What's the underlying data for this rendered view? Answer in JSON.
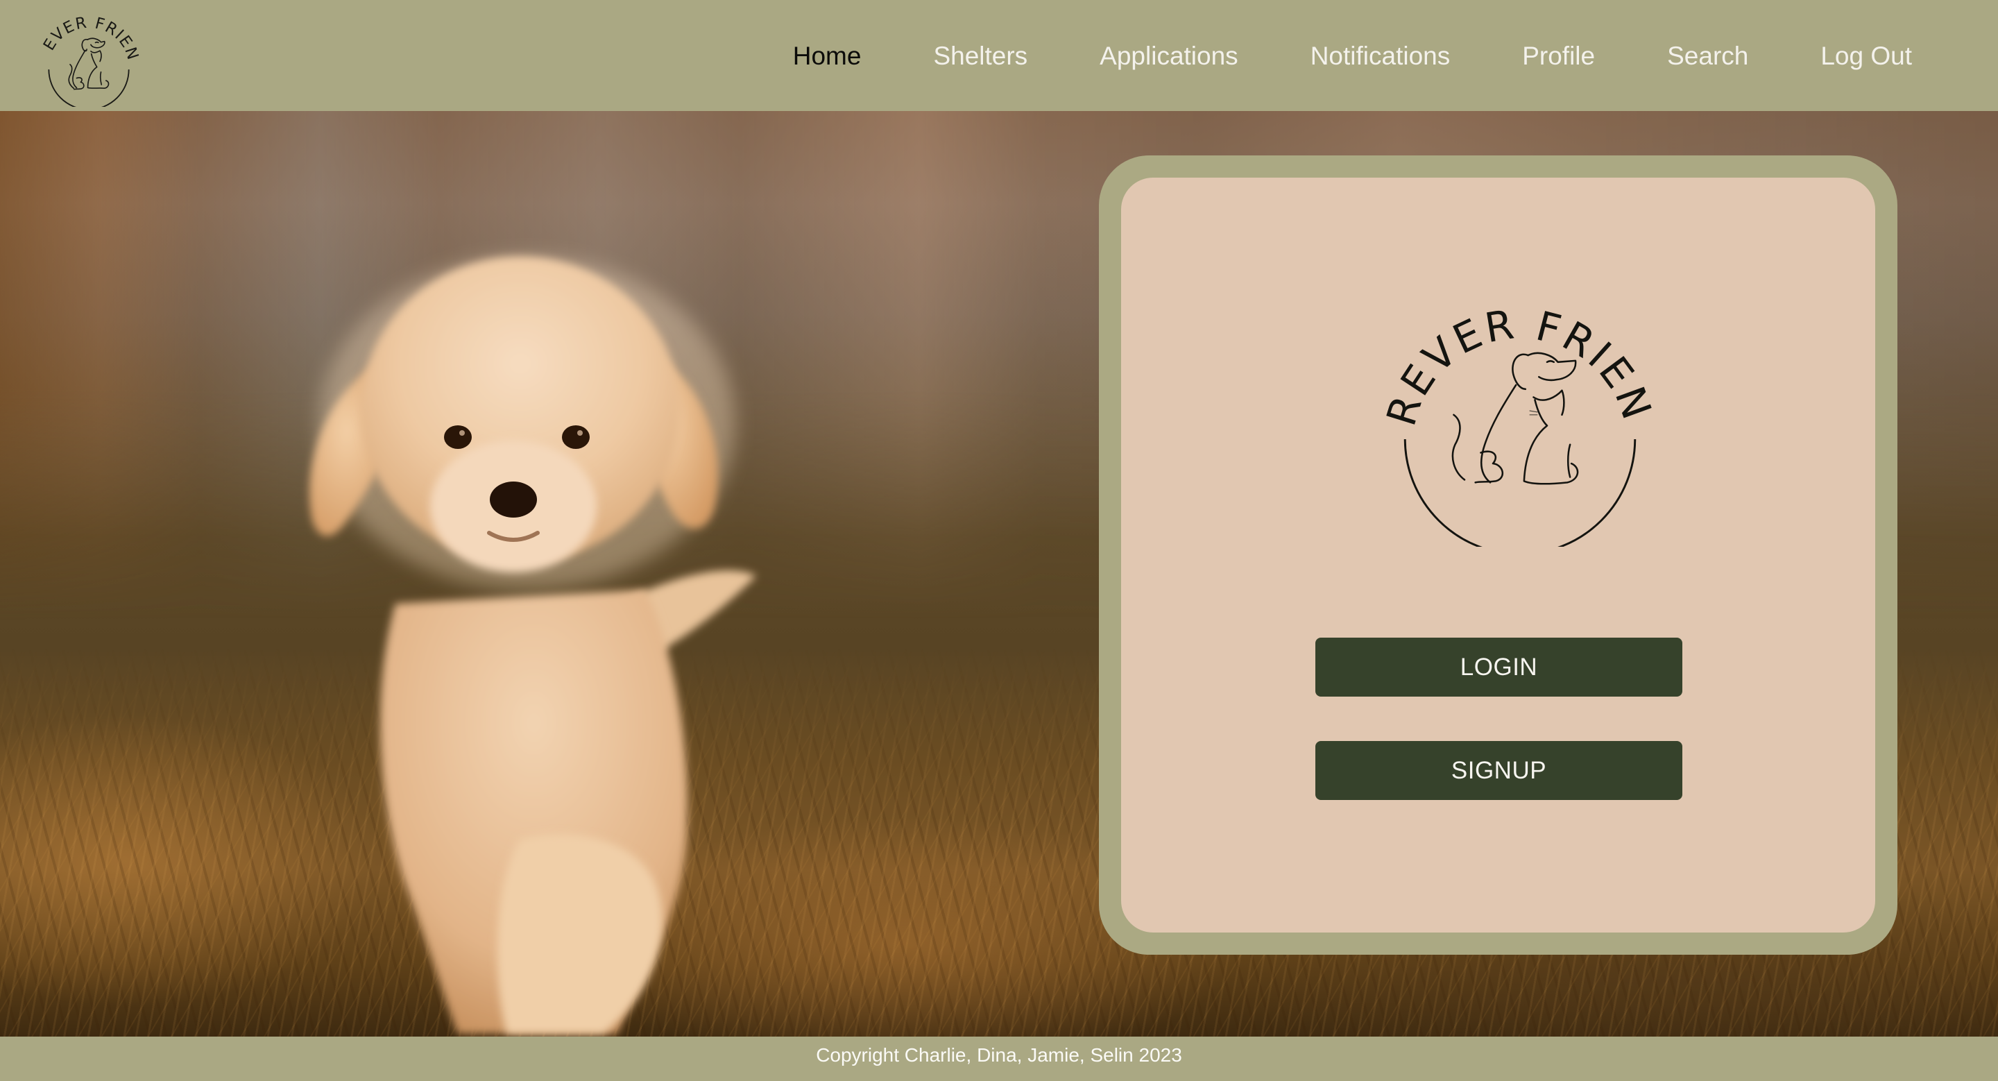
{
  "app": {
    "brand_name": "FUREVER FRIENDS",
    "brand_words": [
      "FUREVER",
      "FRIENDS"
    ]
  },
  "nav": {
    "items": [
      {
        "label": "Home",
        "active": true
      },
      {
        "label": "Shelters",
        "active": false
      },
      {
        "label": "Applications",
        "active": false
      },
      {
        "label": "Notifications",
        "active": false
      },
      {
        "label": "Profile",
        "active": false
      },
      {
        "label": "Search",
        "active": false
      },
      {
        "label": "Log Out",
        "active": false
      }
    ]
  },
  "hero": {
    "image_subject": "golden retriever puppy running on grass at sunset"
  },
  "card": {
    "logo_alt": "Furever Friends logo with dog and cat outline",
    "login_label": "LOGIN",
    "signup_label": "SIGNUP"
  },
  "footer": {
    "text": "Copyright Charlie, Dina, Jamie, Selin 2023"
  },
  "colors": {
    "nav_bg": "#aaa883",
    "card_border": "#aba983",
    "card_bg": "#e1c7b1",
    "button_bg": "#36422b",
    "button_text": "#f7f5f0",
    "nav_active_text": "#0c0c0a",
    "nav_text": "#f4f2ec",
    "footer_text": "#fbfaf6"
  }
}
